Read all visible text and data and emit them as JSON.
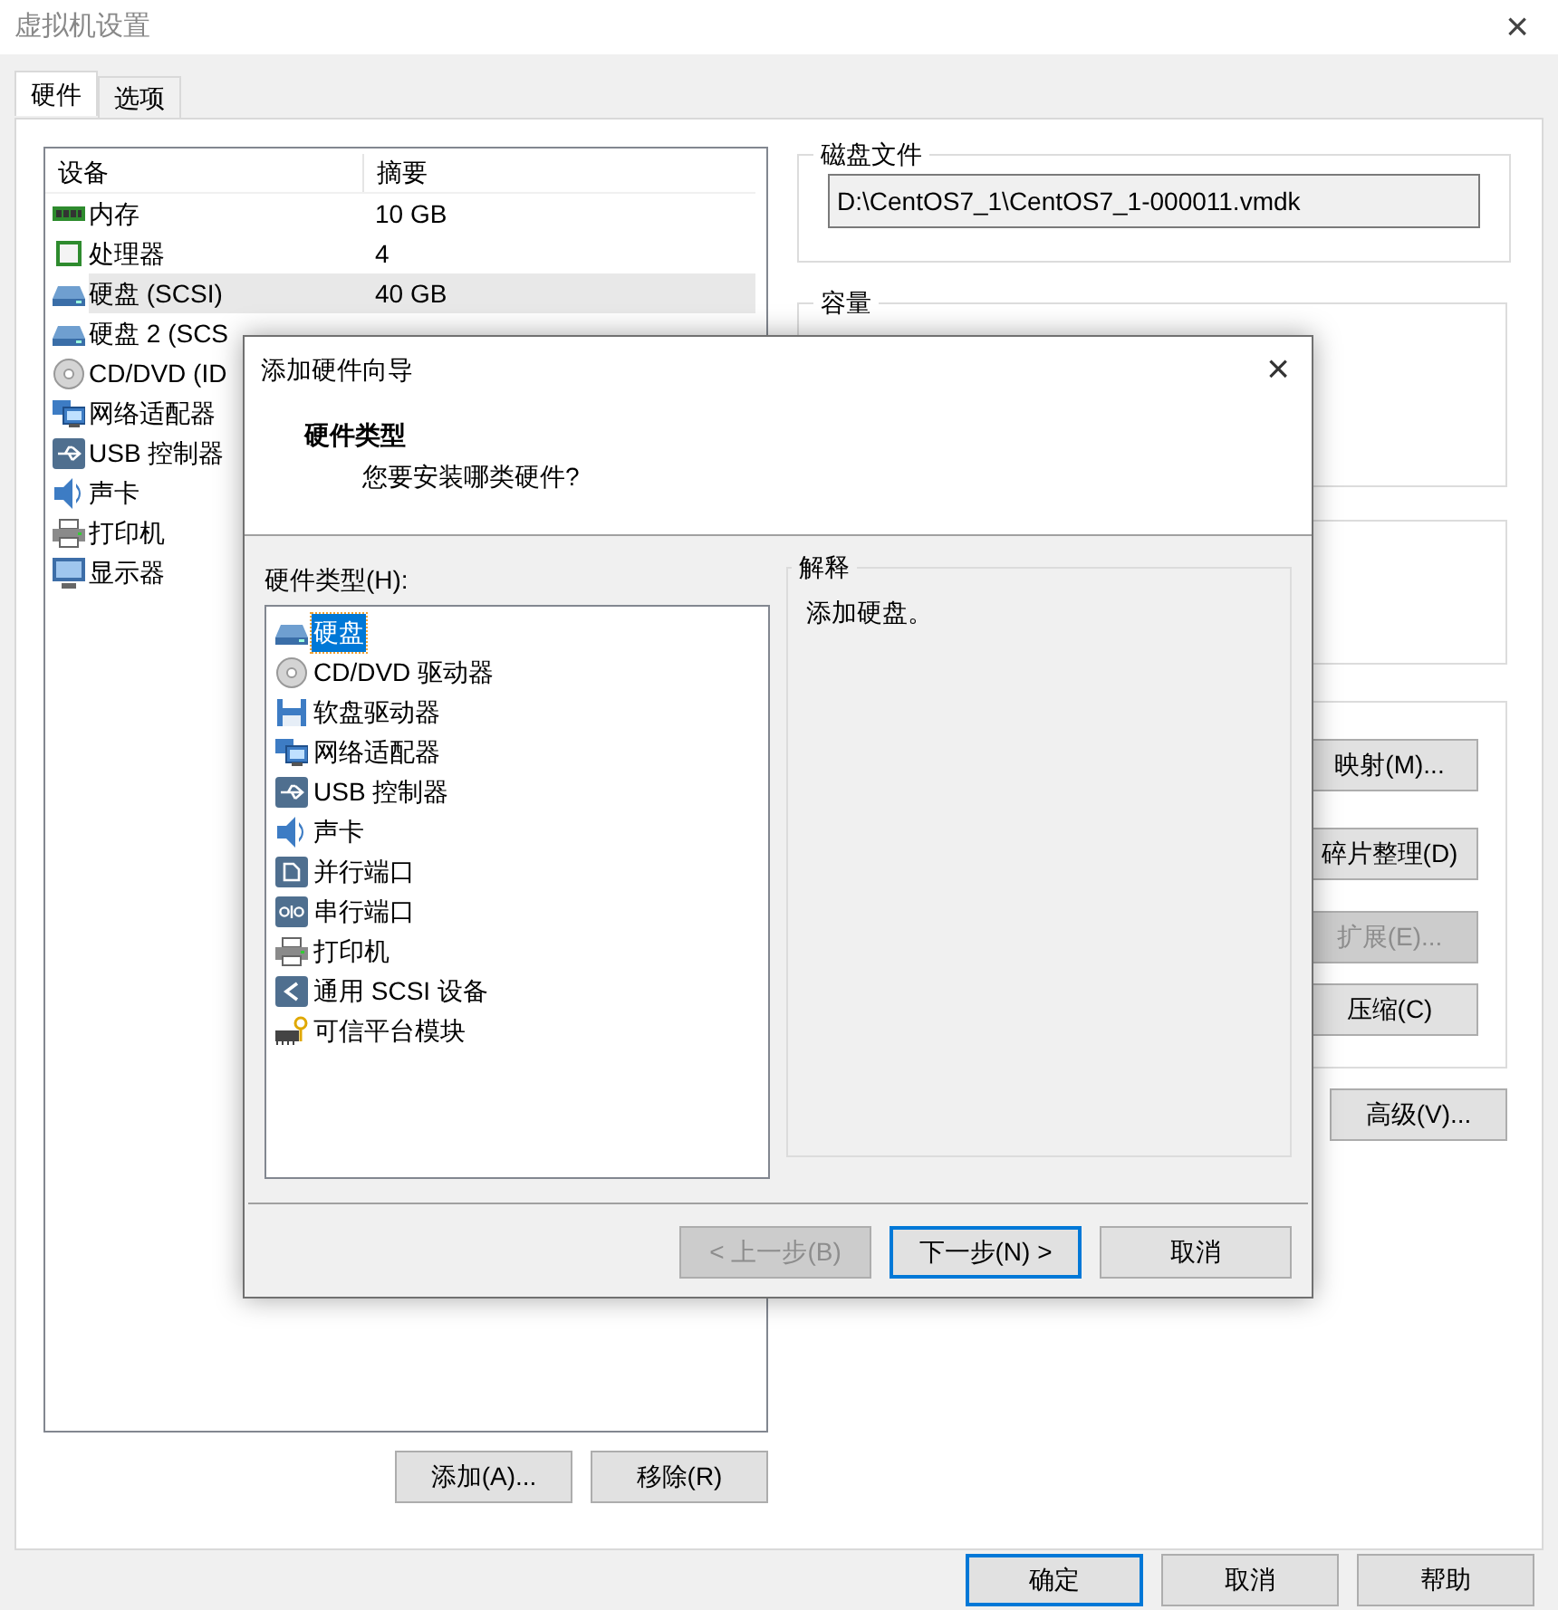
{
  "window": {
    "title": "虚拟机设置",
    "close": "×"
  },
  "tabs": [
    {
      "label": "硬件",
      "selected": true
    },
    {
      "label": "选项",
      "selected": false
    }
  ],
  "devices": {
    "columns": [
      "设备",
      "摘要"
    ],
    "rows": [
      {
        "kind": "memory",
        "name": "内存",
        "summary": "10 GB",
        "selected": false
      },
      {
        "kind": "cpu",
        "name": "处理器",
        "summary": "4",
        "selected": false
      },
      {
        "kind": "disk",
        "name": "硬盘 (SCSI)",
        "summary": "40 GB",
        "selected": true
      },
      {
        "kind": "disk",
        "name": "硬盘 2 (SCS",
        "selected": false
      },
      {
        "kind": "cdrom",
        "name": "CD/DVD (ID",
        "selected": false
      },
      {
        "kind": "network",
        "name": "网络适配器",
        "selected": false
      },
      {
        "kind": "usb",
        "name": "USB 控制器",
        "selected": false
      },
      {
        "kind": "sound",
        "name": "声卡",
        "selected": false
      },
      {
        "kind": "printer",
        "name": "打印机",
        "selected": false
      },
      {
        "kind": "display",
        "name": "显示器",
        "selected": false
      }
    ]
  },
  "device_buttons": [
    "添加(A)...",
    "移除(R)"
  ],
  "disk_file": {
    "title": "磁盘文件",
    "value": "D:\\CentOS7_1\\CentOS7_1-000011.vmdk"
  },
  "capacity": {
    "title": "容量"
  },
  "disk_utilities": [
    {
      "label": "映射(M)...",
      "disabled": false
    },
    {
      "label": "碎片整理(D)",
      "disabled": false
    },
    {
      "label": "扩展(E)...",
      "disabled": true
    },
    {
      "label": "压缩(C)",
      "disabled": false
    }
  ],
  "advanced_button": "高级(V)...",
  "footer_buttons": [
    {
      "label": "确定",
      "default": true
    },
    {
      "label": "取消",
      "default": false
    },
    {
      "label": "帮助",
      "default": false
    }
  ],
  "wizard": {
    "title": "添加硬件向导",
    "close": "×",
    "heading": "硬件类型",
    "subheading": "您要安装哪类硬件?",
    "list_label": "硬件类型(H):",
    "items": [
      {
        "kind": "disk",
        "label": "硬盘",
        "selected": true
      },
      {
        "kind": "cdrom",
        "label": "CD/DVD 驱动器",
        "selected": false
      },
      {
        "kind": "floppy",
        "label": "软盘驱动器",
        "selected": false
      },
      {
        "kind": "network",
        "label": "网络适配器",
        "selected": false
      },
      {
        "kind": "usb",
        "label": "USB 控制器",
        "selected": false
      },
      {
        "kind": "sound",
        "label": "声卡",
        "selected": false
      },
      {
        "kind": "parallel",
        "label": "并行端口",
        "selected": false
      },
      {
        "kind": "serial",
        "label": "串行端口",
        "selected": false
      },
      {
        "kind": "printer",
        "label": "打印机",
        "selected": false
      },
      {
        "kind": "scsi",
        "label": "通用 SCSI 设备",
        "selected": false
      },
      {
        "kind": "tpm",
        "label": "可信平台模块",
        "selected": false
      }
    ],
    "explanation": {
      "title": "解释",
      "text": "添加硬盘。"
    },
    "buttons": [
      {
        "label": "< 上一步(B)",
        "disabled": true,
        "default": false
      },
      {
        "label": "下一步(N) >",
        "disabled": false,
        "default": true
      },
      {
        "label": "取消",
        "disabled": false,
        "default": false
      }
    ]
  }
}
